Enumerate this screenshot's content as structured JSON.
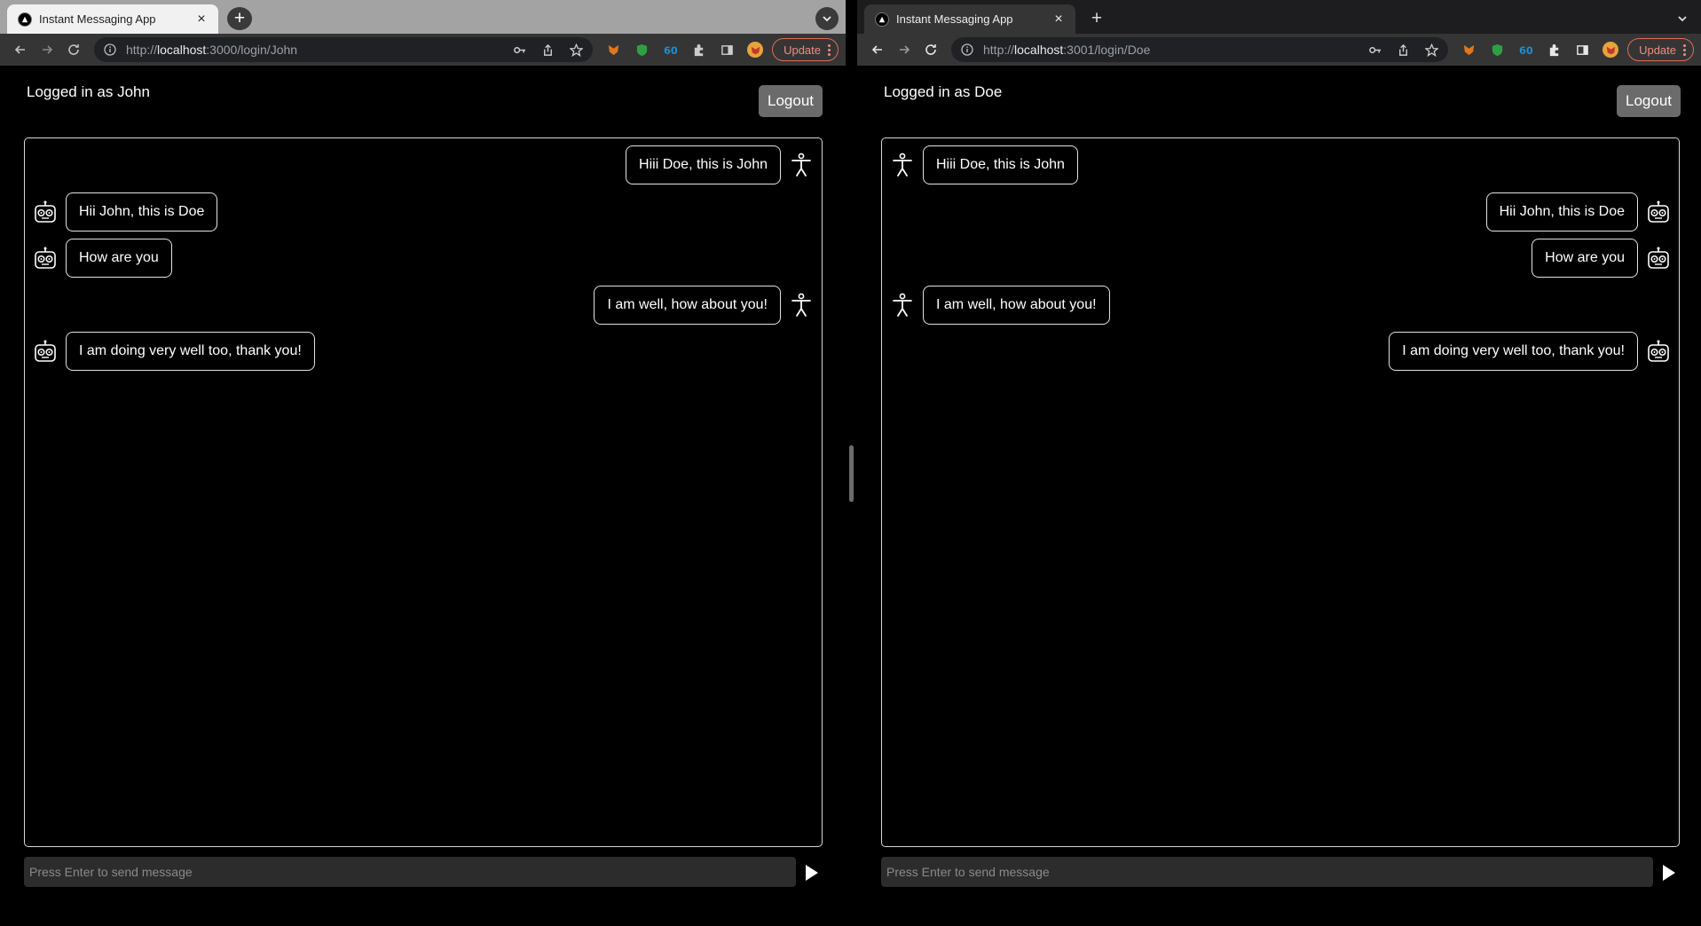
{
  "left": {
    "tab_title": "Instant Messaging App",
    "url_scheme": "http://",
    "url_host": "localhost",
    "url_rest": ":3000/login/John",
    "update_label": "Update",
    "logged_in_text": "Logged in as John",
    "logout_label": "Logout",
    "composer_placeholder": "Press Enter to send message",
    "messages": [
      {
        "text": "Hiii Doe, this is John",
        "side": "mine",
        "icon": "person-icon"
      },
      {
        "text": "Hii John, this is Doe",
        "side": "theirs",
        "icon": "robot-icon"
      },
      {
        "text": "How are you",
        "side": "theirs",
        "icon": "robot-icon"
      },
      {
        "text": "I am well, how about you!",
        "side": "mine",
        "icon": "person-icon"
      },
      {
        "text": "I am doing very well too, thank you!",
        "side": "theirs",
        "icon": "robot-icon"
      }
    ]
  },
  "right": {
    "tab_title": "Instant Messaging App",
    "url_scheme": "http://",
    "url_host": "localhost",
    "url_rest": ":3001/login/Doe",
    "update_label": "Update",
    "logged_in_text": "Logged in as Doe",
    "logout_label": "Logout",
    "composer_placeholder": "Press Enter to send message",
    "messages": [
      {
        "text": "Hiii Doe, this is John",
        "side": "theirs",
        "icon": "person-icon"
      },
      {
        "text": "Hii John, this is Doe",
        "side": "mine",
        "icon": "robot-icon"
      },
      {
        "text": "How are you",
        "side": "mine",
        "icon": "robot-icon"
      },
      {
        "text": "I am well, how about you!",
        "side": "theirs",
        "icon": "person-icon"
      },
      {
        "text": "I am doing very well too, thank you!",
        "side": "mine",
        "icon": "robot-icon"
      }
    ]
  },
  "colors": {
    "background": "#000000",
    "bubble_border": "#e3e3e3",
    "logout_bg": "#6b6b6b",
    "update_accent": "#f28b82"
  }
}
